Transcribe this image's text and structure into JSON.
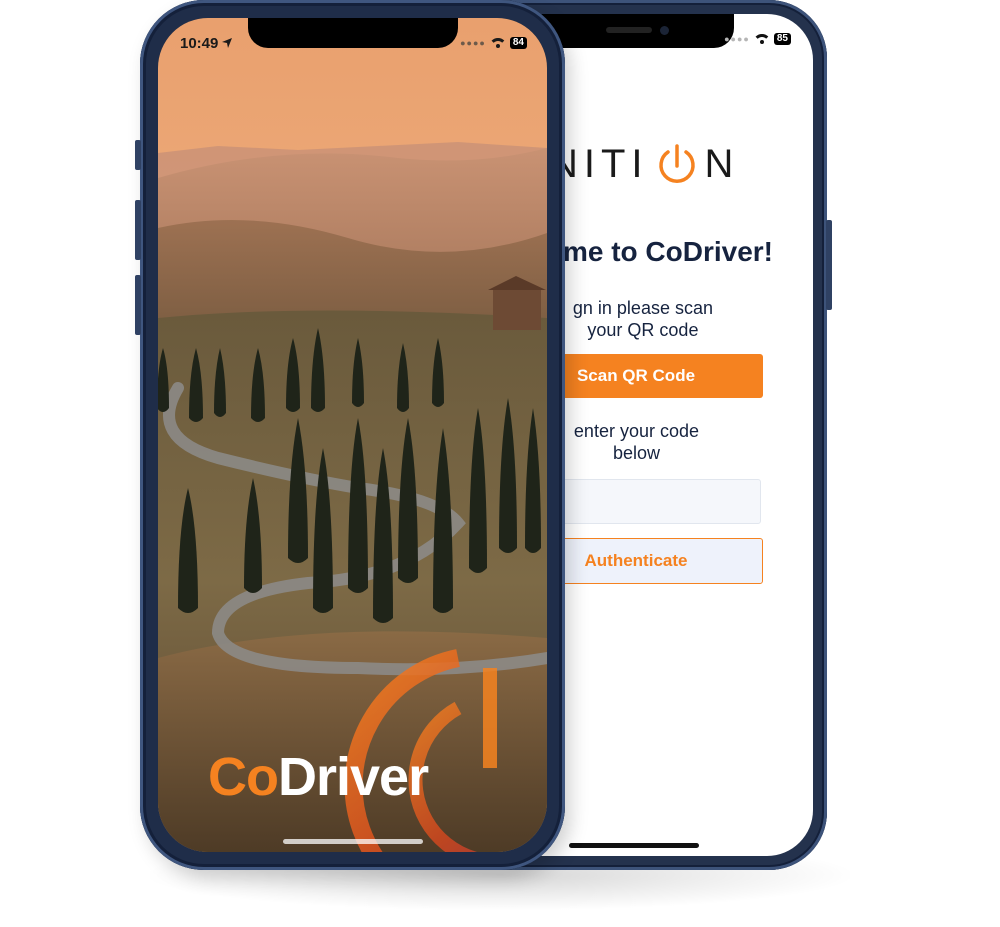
{
  "back_screen": {
    "status": {
      "battery": "85"
    },
    "logo": {
      "text_left": "NITI",
      "text_right": "N"
    },
    "welcome": "me to CoDriver!",
    "scan_instruction": [
      "gn in please scan",
      "your QR code"
    ],
    "scan_button": "Scan QR Code",
    "code_instruction": [
      "enter your code",
      "below"
    ],
    "code_input": {
      "value": "",
      "placeholder": ""
    },
    "auth_button": "Authenticate"
  },
  "front_screen": {
    "status": {
      "time": "10:49",
      "battery": "84"
    },
    "brand": {
      "part1": "Co",
      "part2": "Driver"
    }
  },
  "colors": {
    "accent": "#f58220",
    "heading": "#16233f",
    "phone_frame": "#1f2d49"
  }
}
